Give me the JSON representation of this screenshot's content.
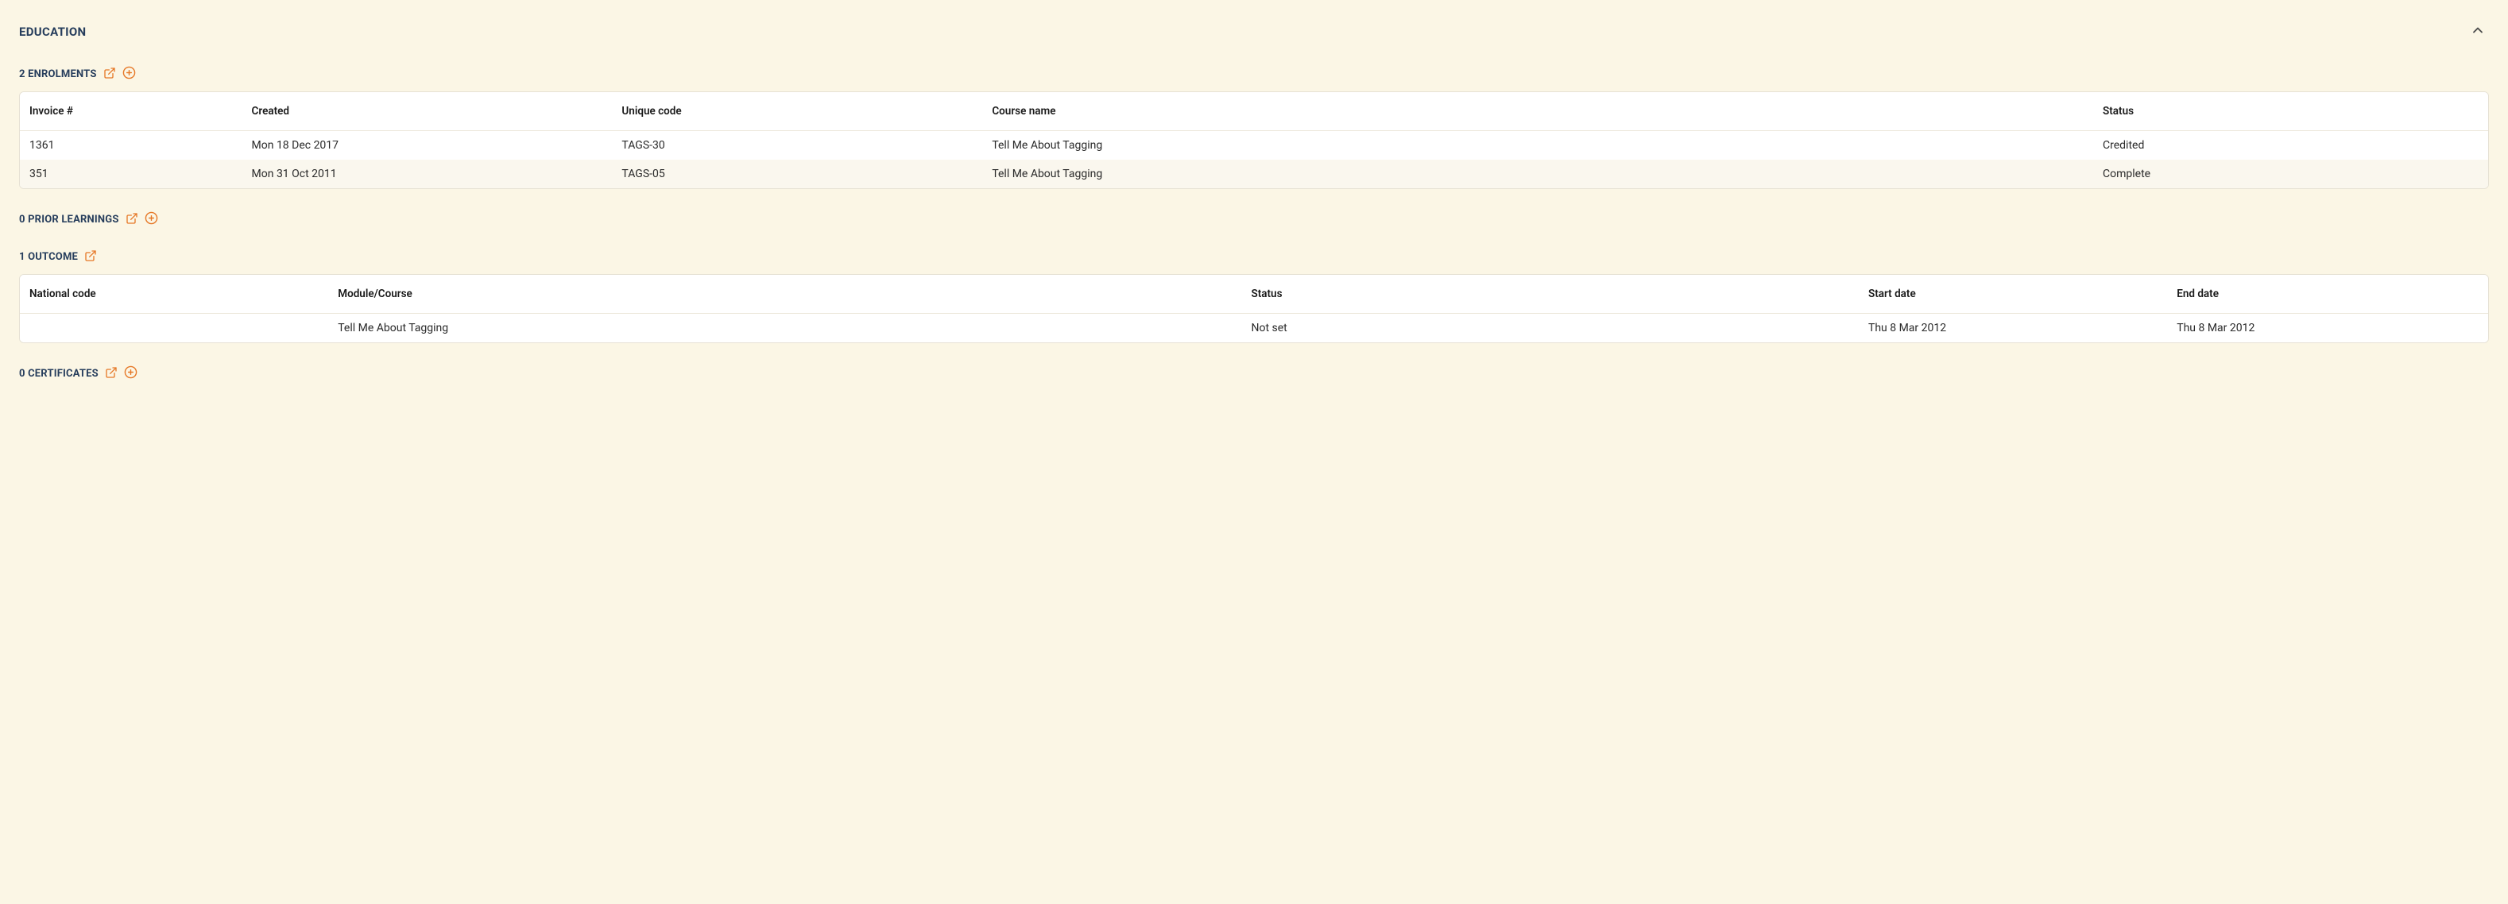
{
  "panel": {
    "title": "EDUCATION"
  },
  "enrolments": {
    "heading": "2 ENROLMENTS",
    "columns": {
      "invoice": "Invoice #",
      "created": "Created",
      "uniqueCode": "Unique code",
      "courseName": "Course name",
      "status": "Status"
    },
    "rows": [
      {
        "invoice": "1361",
        "created": "Mon 18 Dec 2017",
        "uniqueCode": "TAGS-30",
        "courseName": "Tell Me About Tagging",
        "status": "Credited"
      },
      {
        "invoice": "351",
        "created": "Mon 31 Oct 2011",
        "uniqueCode": "TAGS-05",
        "courseName": "Tell Me About Tagging",
        "status": "Complete"
      }
    ]
  },
  "priorLearnings": {
    "heading": "0 PRIOR LEARNINGS"
  },
  "outcome": {
    "heading": "1 OUTCOME",
    "columns": {
      "nationalCode": "National code",
      "moduleCourse": "Module/Course",
      "status": "Status",
      "startDate": "Start date",
      "endDate": "End date"
    },
    "rows": [
      {
        "nationalCode": "",
        "moduleCourse": "Tell Me About Tagging",
        "status": "Not set",
        "startDate": "Thu 8 Mar 2012",
        "endDate": "Thu 8 Mar 2012"
      }
    ]
  },
  "certificates": {
    "heading": "0 CERTIFICATES"
  }
}
